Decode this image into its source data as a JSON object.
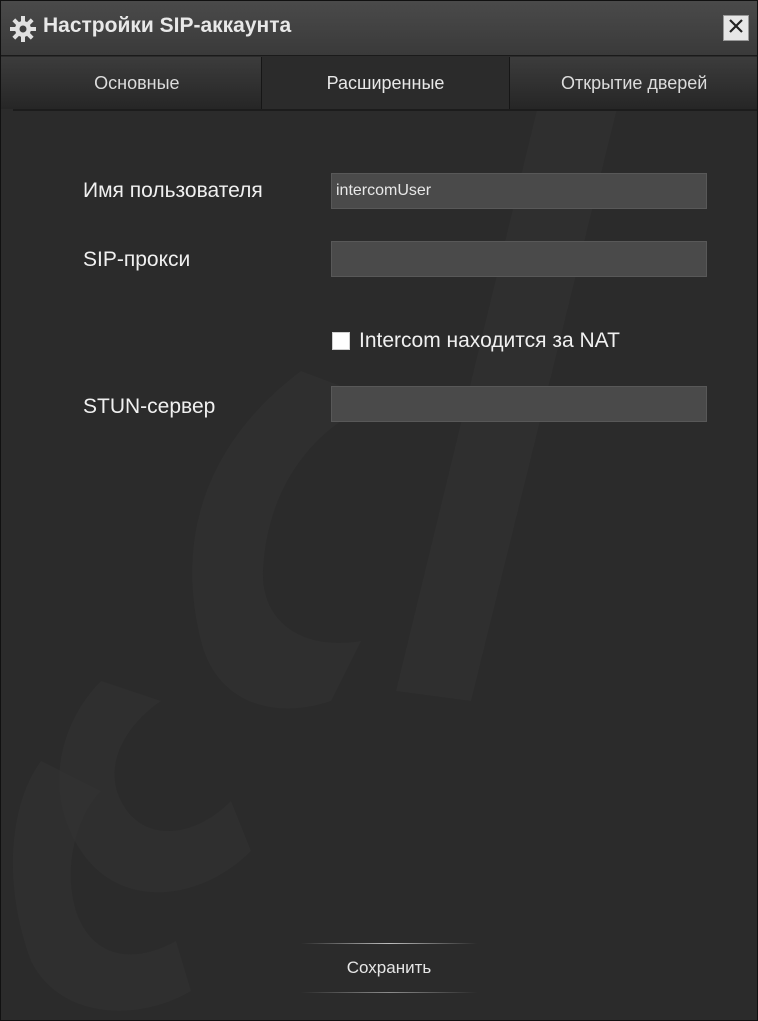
{
  "window": {
    "title": "Настройки SIP-аккаунта",
    "icon": "gear-icon",
    "close_icon": "close-icon"
  },
  "tabs": [
    {
      "label": "Основные",
      "active": false
    },
    {
      "label": "Расширенные",
      "active": true
    },
    {
      "label": "Открытие дверей",
      "active": false
    }
  ],
  "form": {
    "username_label": "Имя пользователя",
    "username_value": "intercomUser",
    "sip_proxy_label": "SIP-прокси",
    "sip_proxy_value": "",
    "nat_checkbox_label": "Intercom находится за NAT",
    "nat_checked": false,
    "stun_label": "STUN-сервер",
    "stun_value": ""
  },
  "footer": {
    "save_label": "Сохранить"
  }
}
